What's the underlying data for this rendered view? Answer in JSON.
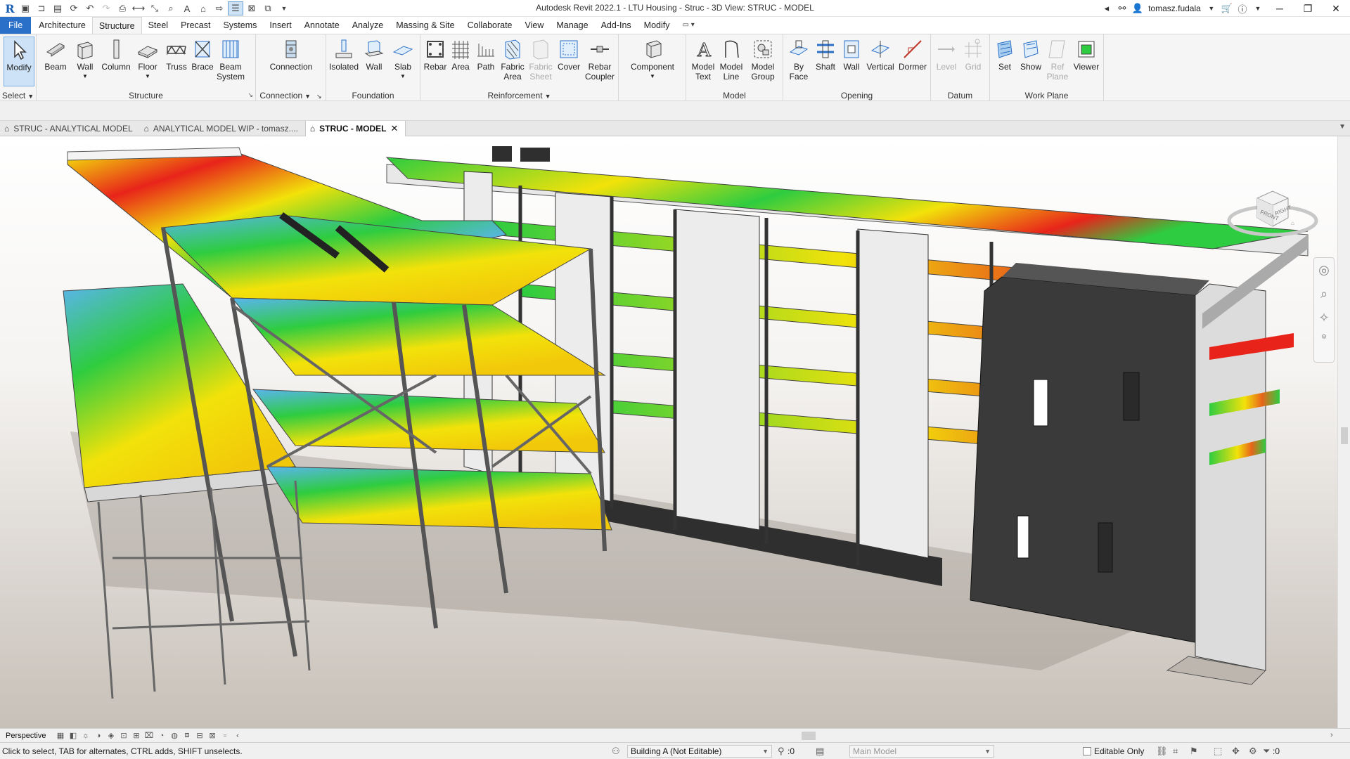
{
  "window": {
    "title": "Autodesk Revit 2022.1 - LTU Housing - Struc - 3D View: STRUC - MODEL",
    "user": "tomasz.fudala"
  },
  "menu": {
    "file": "File",
    "tabs": [
      "Architecture",
      "Structure",
      "Steel",
      "Precast",
      "Systems",
      "Insert",
      "Annotate",
      "Analyze",
      "Massing & Site",
      "Collaborate",
      "View",
      "Manage",
      "Add-Ins",
      "Modify"
    ]
  },
  "ribbon": {
    "select_label": "Select",
    "panels": {
      "structure": "Structure",
      "connection": "Connection",
      "foundation": "Foundation",
      "reinforcement": "Reinforcement",
      "model": "Model",
      "opening": "Opening",
      "datum": "Datum",
      "work_plane": "Work Plane"
    },
    "buttons": {
      "modify": "Modify",
      "beam": "Beam",
      "wall": "Wall",
      "column": "Column",
      "floor": "Floor",
      "truss": "Truss",
      "brace": "Brace",
      "beam_system": "Beam\nSystem",
      "connection": "Connection",
      "isolated": "Isolated",
      "found_wall": "Wall",
      "slab": "Slab",
      "rebar": "Rebar",
      "area": "Area",
      "path": "Path",
      "fabric_area": "Fabric\nArea",
      "fabric_sheet": "Fabric\nSheet",
      "cover": "Cover",
      "rebar_coupler": "Rebar\nCoupler",
      "component": "Component",
      "model_text": "Model\nText",
      "model_line": "Model\nLine",
      "model_group": "Model\nGroup",
      "by_face": "By\nFace",
      "shaft": "Shaft",
      "open_wall": "Wall",
      "vertical": "Vertical",
      "dormer": "Dormer",
      "level": "Level",
      "grid": "Grid",
      "set": "Set",
      "show": "Show",
      "ref_plane": "Ref\nPlane",
      "viewer": "Viewer"
    }
  },
  "doc_tabs": [
    {
      "label": "STRUC - ANALYTICAL MODEL",
      "active": false
    },
    {
      "label": "ANALYTICAL MODEL WIP - tomasz....",
      "active": false
    },
    {
      "label": "STRUC - MODEL",
      "active": true
    }
  ],
  "viewcube": {
    "front": "FRONT",
    "right": "RIGHT"
  },
  "view_control": {
    "projection": "Perspective"
  },
  "status": {
    "message": "Click to select, TAB for alternates, CTRL adds, SHIFT unselects.",
    "workset": "Building A (Not Editable)",
    "selection_count": ":0",
    "design_option": "Main Model",
    "editable_only": "Editable Only",
    "filter_count": ":0"
  },
  "colors": {
    "file_tab": "#2b70c8",
    "active_tab_bg": "#f5f5f5",
    "ribbon_bg": "#f5f5f5",
    "heat_low": "#5ab4f0",
    "heat_mid": "#2ecc40",
    "heat_high": "#f2e20a",
    "heat_peak": "#e8241a",
    "core_wall": "#3a3a3a"
  }
}
